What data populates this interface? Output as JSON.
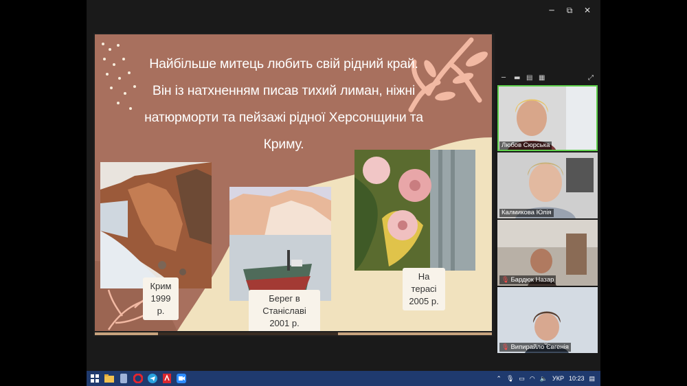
{
  "window": {
    "controls": {
      "minimize": "─",
      "restore": "⧉",
      "close": "✕"
    }
  },
  "slide": {
    "lines": [
      "Найбільше митець любить свій рідний край.",
      "Він із натхненням писав тихий лиман, ніжні",
      "натюрморти та пейзажі рідної Херсонщини та",
      "Криму."
    ],
    "paintings": [
      {
        "caption_line1": "Крим",
        "caption_line2": "1999 р."
      },
      {
        "caption_line1": "Берег в Станіславі",
        "caption_line2": "2001 р."
      },
      {
        "caption_line1": "На терасі",
        "caption_line2": "2005 р."
      }
    ],
    "colors": {
      "brown": "#a8705e",
      "cream": "#f1e2be",
      "pink": "#f2b9a3"
    }
  },
  "gallery": {
    "participants": [
      {
        "name": "Любов Сюрська",
        "muted": false,
        "active": true
      },
      {
        "name": "Калмикова Юлія",
        "muted": false,
        "active": false
      },
      {
        "name": "Бардюк Назар",
        "muted": true,
        "active": false
      },
      {
        "name": "Випирайло Євгенія",
        "muted": true,
        "active": false
      }
    ]
  },
  "taskbar": {
    "language": "УКР",
    "time": "10:23",
    "icons": [
      "windows-icon",
      "file-explorer-icon",
      "phone-icon",
      "opera-icon",
      "telegram-icon",
      "pdf-icon",
      "zoom-icon"
    ]
  }
}
